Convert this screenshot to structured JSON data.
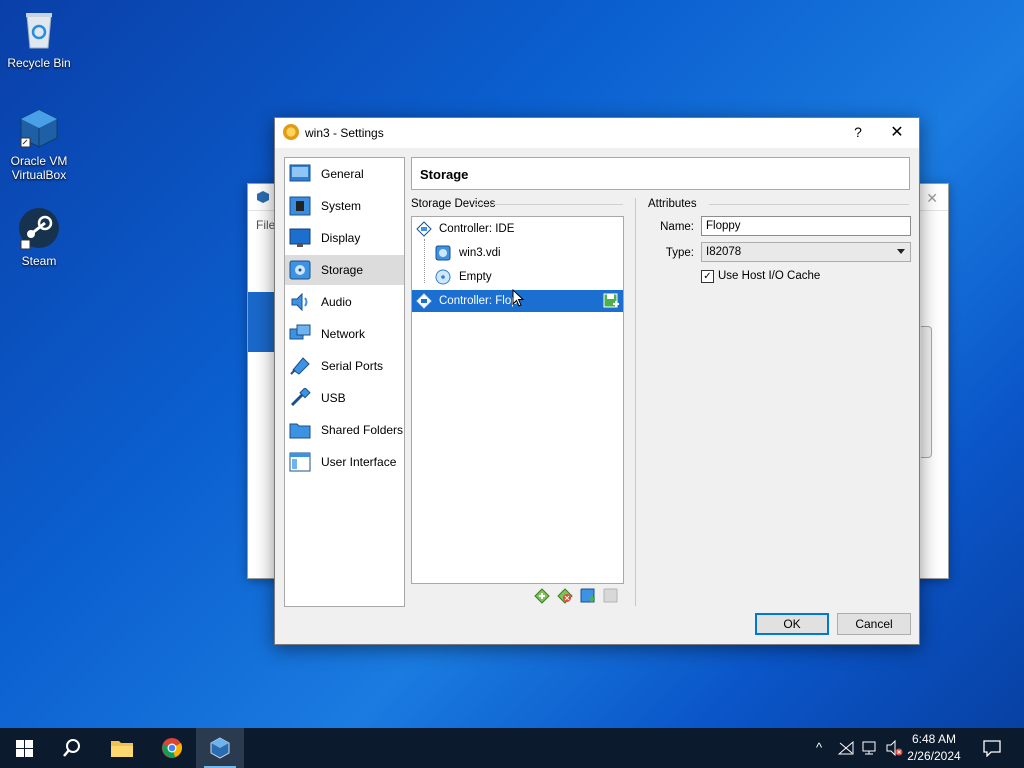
{
  "desktop": {
    "icons": [
      {
        "label": "Recycle Bin"
      },
      {
        "label": "Oracle VM VirtualBox"
      },
      {
        "label": "Steam"
      }
    ]
  },
  "background_window": {
    "menu_label": "File"
  },
  "dialog": {
    "title": "win3 - Settings",
    "help": "?",
    "close": "✕",
    "nav": [
      {
        "label": "General",
        "icon": "general-icon"
      },
      {
        "label": "System",
        "icon": "system-icon"
      },
      {
        "label": "Display",
        "icon": "display-icon"
      },
      {
        "label": "Storage",
        "icon": "storage-icon",
        "active": true
      },
      {
        "label": "Audio",
        "icon": "audio-icon"
      },
      {
        "label": "Network",
        "icon": "network-icon"
      },
      {
        "label": "Serial Ports",
        "icon": "serial-ports-icon"
      },
      {
        "label": "USB",
        "icon": "usb-icon"
      },
      {
        "label": "Shared Folders",
        "icon": "shared-folders-icon"
      },
      {
        "label": "User Interface",
        "icon": "user-interface-icon"
      }
    ],
    "section_title": "Storage",
    "storage_devices_label": "Storage Devices",
    "attributes_label": "Attributes",
    "tree": [
      {
        "label": "Controller: IDE",
        "level": 0,
        "icon": "ide-controller-icon"
      },
      {
        "label": "win3.vdi",
        "level": 1,
        "icon": "hard-disk-icon"
      },
      {
        "label": "Empty",
        "level": 1,
        "icon": "optical-disc-icon"
      },
      {
        "label": "Controller: Flop",
        "level": 0,
        "icon": "floppy-controller-icon",
        "selected": true
      }
    ],
    "attributes": {
      "name_label": "Name:",
      "name_value": "Floppy",
      "type_label": "Type:",
      "type_value": "I82078",
      "cache_label": "Use Host I/O Cache",
      "cache_checked": true
    },
    "ok": "OK",
    "cancel": "Cancel"
  },
  "taskbar": {
    "time": "6:48 AM",
    "date": "2/26/2024"
  }
}
